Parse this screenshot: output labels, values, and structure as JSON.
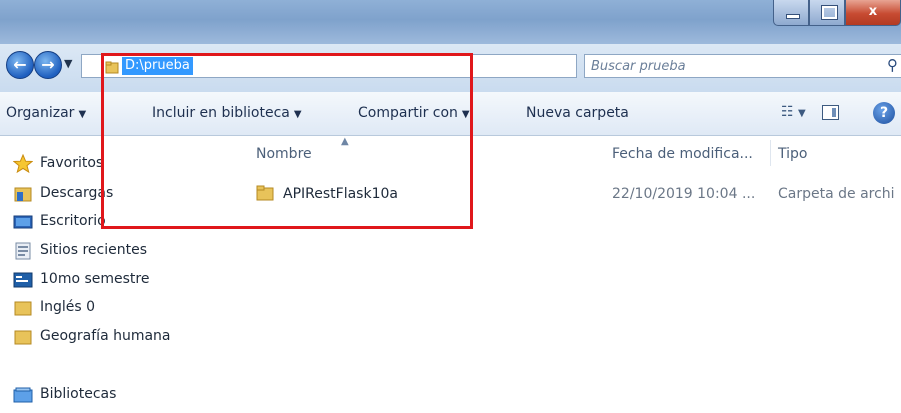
{
  "window": {
    "address": "D:\\prueba",
    "search_placeholder": "Buscar prueba",
    "controls": {
      "minimize": "–",
      "maximize": "□",
      "close": "x"
    }
  },
  "toolbar": {
    "organize": "Organizar",
    "include_library": "Incluir en biblioteca",
    "share_with": "Compartir con",
    "new_folder": "Nueva carpeta"
  },
  "nav": {
    "favorites": "Favoritos",
    "items": [
      "Descargas",
      "Escritorio",
      "Sitios recientes",
      "10mo semestre",
      "Inglés 0",
      "Geografía humana"
    ],
    "libraries": "Bibliotecas"
  },
  "columns": {
    "name": "Nombre",
    "date": "Fecha de modifica...",
    "type": "Tipo"
  },
  "files": [
    {
      "name": "APIRestFlask10a",
      "date": "22/10/2019 10:04 ...",
      "type": "Carpeta de archi"
    }
  ],
  "colors": {
    "highlight": "#e0171b",
    "selection": "#3399ff",
    "folder": "#e8c35a"
  }
}
